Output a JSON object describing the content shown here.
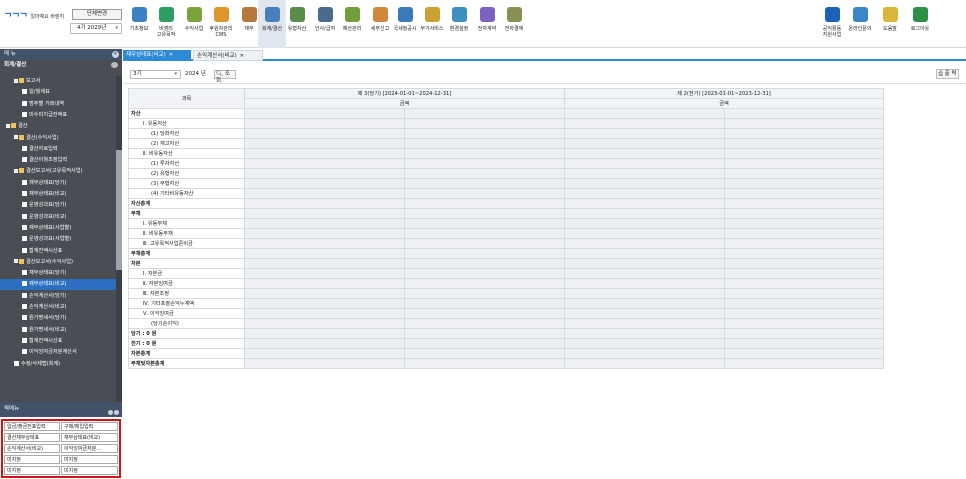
{
  "header": {
    "logo_mark": "ᄀᄀᄀ",
    "logo_text": "일마예요 바렌히",
    "dept_button": "단체변경",
    "year_select": "4기 2029년"
  },
  "modules": [
    {
      "label": "기초정보",
      "color": "#3b82c4"
    },
    {
      "label": "비영리\n고유목적",
      "color": "#2e9e62"
    },
    {
      "label": "수익사업",
      "color": "#7aa33a"
    },
    {
      "label": "후원자관리\nCMS",
      "color": "#e0962b"
    },
    {
      "label": "재무",
      "color": "#b57a3c"
    },
    {
      "label": "회계/결산",
      "color": "#4a7fbd",
      "active": true
    },
    {
      "label": "유형자산",
      "color": "#5a8c4a"
    },
    {
      "label": "인사/급여",
      "color": "#4a6c8c"
    },
    {
      "label": "예산관리",
      "color": "#6f9e3a"
    },
    {
      "label": "세무신고",
      "color": "#d2883a"
    },
    {
      "label": "국세청공시",
      "color": "#3a7ab6"
    },
    {
      "label": "부가서비스",
      "color": "#c9a233"
    },
    {
      "label": "환경설정",
      "color": "#3c8fbf"
    },
    {
      "label": "전자계약",
      "color": "#7b61c2"
    },
    {
      "label": "전자결재",
      "color": "#8a8f54"
    }
  ],
  "right_modules": [
    {
      "label": "공익활동\n지원사업",
      "color": "#1b63b8"
    },
    {
      "label": "온라인문의",
      "color": "#3a86c8"
    },
    {
      "label": "도움말",
      "color": "#d9b63a"
    },
    {
      "label": "로그아웃",
      "color": "#2e8f47"
    }
  ],
  "menu": {
    "title": "메 뉴",
    "close_symbol": "✕",
    "section_title": "회계/결산",
    "items": [
      {
        "label": "보고서",
        "level": 1,
        "type": "folder"
      },
      {
        "label": "일/월계표",
        "level": 2,
        "type": "doc"
      },
      {
        "label": "범주별 거래내역",
        "level": 2,
        "type": "doc"
      },
      {
        "label": "미수미지급잔액표",
        "level": 2,
        "type": "doc"
      },
      {
        "label": "결산",
        "level": 0,
        "type": "folder"
      },
      {
        "label": "결산(수익사업)",
        "level": 1,
        "type": "folder"
      },
      {
        "label": "결산자료입력",
        "level": 2,
        "type": "doc"
      },
      {
        "label": "결산이월조정입력",
        "level": 2,
        "type": "doc"
      },
      {
        "label": "결산보고서(고유목적사업)",
        "level": 1,
        "type": "folder"
      },
      {
        "label": "재무상태표(당기)",
        "level": 2,
        "type": "doc"
      },
      {
        "label": "재무상태표(비교)",
        "level": 2,
        "type": "doc"
      },
      {
        "label": "운영성과표(당기)",
        "level": 2,
        "type": "doc"
      },
      {
        "label": "운영성과표(비교)",
        "level": 2,
        "type": "doc"
      },
      {
        "label": "재무상태표(사업별)",
        "level": 2,
        "type": "doc"
      },
      {
        "label": "운영성과표(사업별)",
        "level": 2,
        "type": "doc"
      },
      {
        "label": "합계잔액시산표",
        "level": 2,
        "type": "doc"
      },
      {
        "label": "결산보고서(수익사업)",
        "level": 1,
        "type": "folder"
      },
      {
        "label": "재무상태표(당기)",
        "level": 2,
        "type": "doc"
      },
      {
        "label": "재무상태표(비교)",
        "level": 2,
        "type": "doc",
        "selected": true
      },
      {
        "label": "손익계산서(당기)",
        "level": 2,
        "type": "doc"
      },
      {
        "label": "손익계산서(비교)",
        "level": 2,
        "type": "doc"
      },
      {
        "label": "원가명세서(당기)",
        "level": 2,
        "type": "doc"
      },
      {
        "label": "원가명세서(비교)",
        "level": 2,
        "type": "doc"
      },
      {
        "label": "합계잔액시산표",
        "level": 2,
        "type": "doc"
      },
      {
        "label": "이익잉여금처분계산서",
        "level": 2,
        "type": "doc"
      },
      {
        "label": "수정/삭제탭(회계)",
        "level": 1,
        "type": "doc"
      }
    ]
  },
  "quick_menu": {
    "title": "퀵메뉴",
    "items": [
      "입금/출금전표입력",
      "구매/매입입력",
      "결산재무상태표",
      "재무상태표(비교)",
      "손익계산서(비교)",
      "이익잉여금처분…",
      "미지정",
      "미지정",
      "미지정",
      "미지정"
    ]
  },
  "tabs": [
    {
      "label": "재무상태표(비교)",
      "active": true
    },
    {
      "label": "손익계산서(비교)",
      "active": false
    }
  ],
  "filter": {
    "select_value": "3기",
    "year_label": "2024 년",
    "search_label": "조 회",
    "print_label": "출 력"
  },
  "table": {
    "col_account": "과목",
    "period1_label": "제 3(당기) [2024-01-01~2024-12-31]",
    "period2_label": "제 2(전기) [2023-01-01~2023-12-31]",
    "amount_label": "금액",
    "rows": [
      {
        "label": "자산",
        "bold": true
      },
      {
        "label": "Ⅰ. 유동자산"
      },
      {
        "label": "(1) 당좌자산"
      },
      {
        "label": "(2) 재고자산"
      },
      {
        "label": "Ⅱ. 비유동자산"
      },
      {
        "label": "(1) 투자자산"
      },
      {
        "label": "(2) 유형자산"
      },
      {
        "label": "(3) 무형자산"
      },
      {
        "label": "(4) 기타비유동자산"
      },
      {
        "label": "자산총계",
        "bold": true
      },
      {
        "label": "부채",
        "bold": true
      },
      {
        "label": "Ⅰ. 유동부채"
      },
      {
        "label": "Ⅱ. 비유동부채"
      },
      {
        "label": "Ⅲ. 고유목적사업준비금"
      },
      {
        "label": "부채총계",
        "bold": true
      },
      {
        "label": "자본",
        "bold": true
      },
      {
        "label": "Ⅰ. 자본금"
      },
      {
        "label": "Ⅱ. 자본잉여금"
      },
      {
        "label": "Ⅲ. 자본조정"
      },
      {
        "label": "Ⅳ. 기타포괄손익누계액"
      },
      {
        "label": "Ⅴ. 이익잉여금"
      },
      {
        "label": "(당기순이익)"
      },
      {
        "label": "당기 : 0 원",
        "bold": true
      },
      {
        "label": "전기 : 0 원",
        "bold": true
      },
      {
        "label": "자본총계",
        "bold": true
      },
      {
        "label": "부채및자본총계",
        "bold": true
      }
    ]
  }
}
